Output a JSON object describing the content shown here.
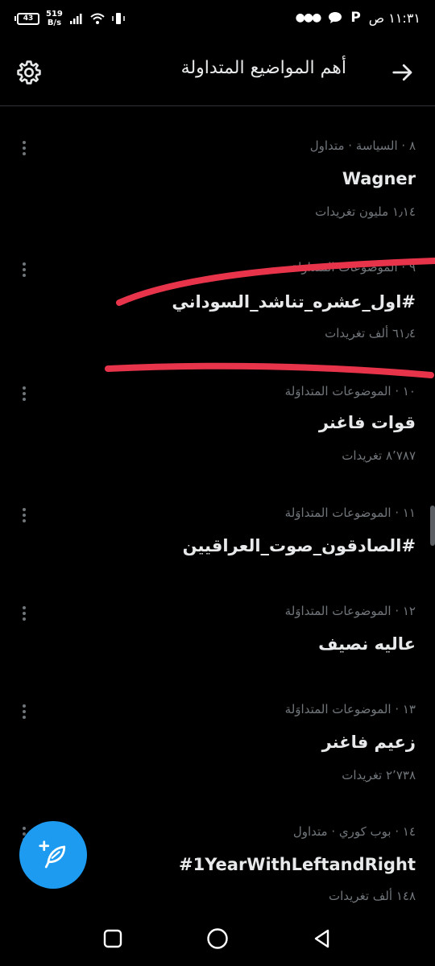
{
  "status_bar": {
    "battery": "43",
    "speed_value": "519",
    "speed_unit": "B/s",
    "time": "١١:٣١ ص",
    "carrier_badge": "P"
  },
  "header": {
    "title": "أهم المواضيع المتداولة"
  },
  "trends": [
    {
      "meta": "٨ · السياسة · متداول",
      "name": "Wagner",
      "count": "١٫١٤ مليون تغريدات"
    },
    {
      "meta": "٩ · الموضوعات المتداوَلة",
      "name": "#اول_عشره_تناشد_السوداني",
      "count": "٦١٫٤ ألف تغريدات"
    },
    {
      "meta": "١٠ · الموضوعات المتداوَلة",
      "name": "قوات فاغنر",
      "count": "٨٬٧٨٧ تغريدات"
    },
    {
      "meta": "١١ · الموضوعات المتداوَلة",
      "name": "#الصادقون_صوت_العراقيين",
      "count": ""
    },
    {
      "meta": "١٢ · الموضوعات المتداوَلة",
      "name": "عاليه نصيف",
      "count": ""
    },
    {
      "meta": "١٣ · الموضوعات المتداوَلة",
      "name": "زعيم فاغنر",
      "count": "٢٬٧٣٨ تغريدات"
    },
    {
      "meta": "١٤ · بوب كوري · متداول",
      "name": "#1YearWithLeftandRight",
      "count": "١٤٨ ألف تغريدات"
    }
  ],
  "colors": {
    "accent": "#1d9bf0",
    "annotation": "#e8344a",
    "secondary_text": "#71767b"
  }
}
